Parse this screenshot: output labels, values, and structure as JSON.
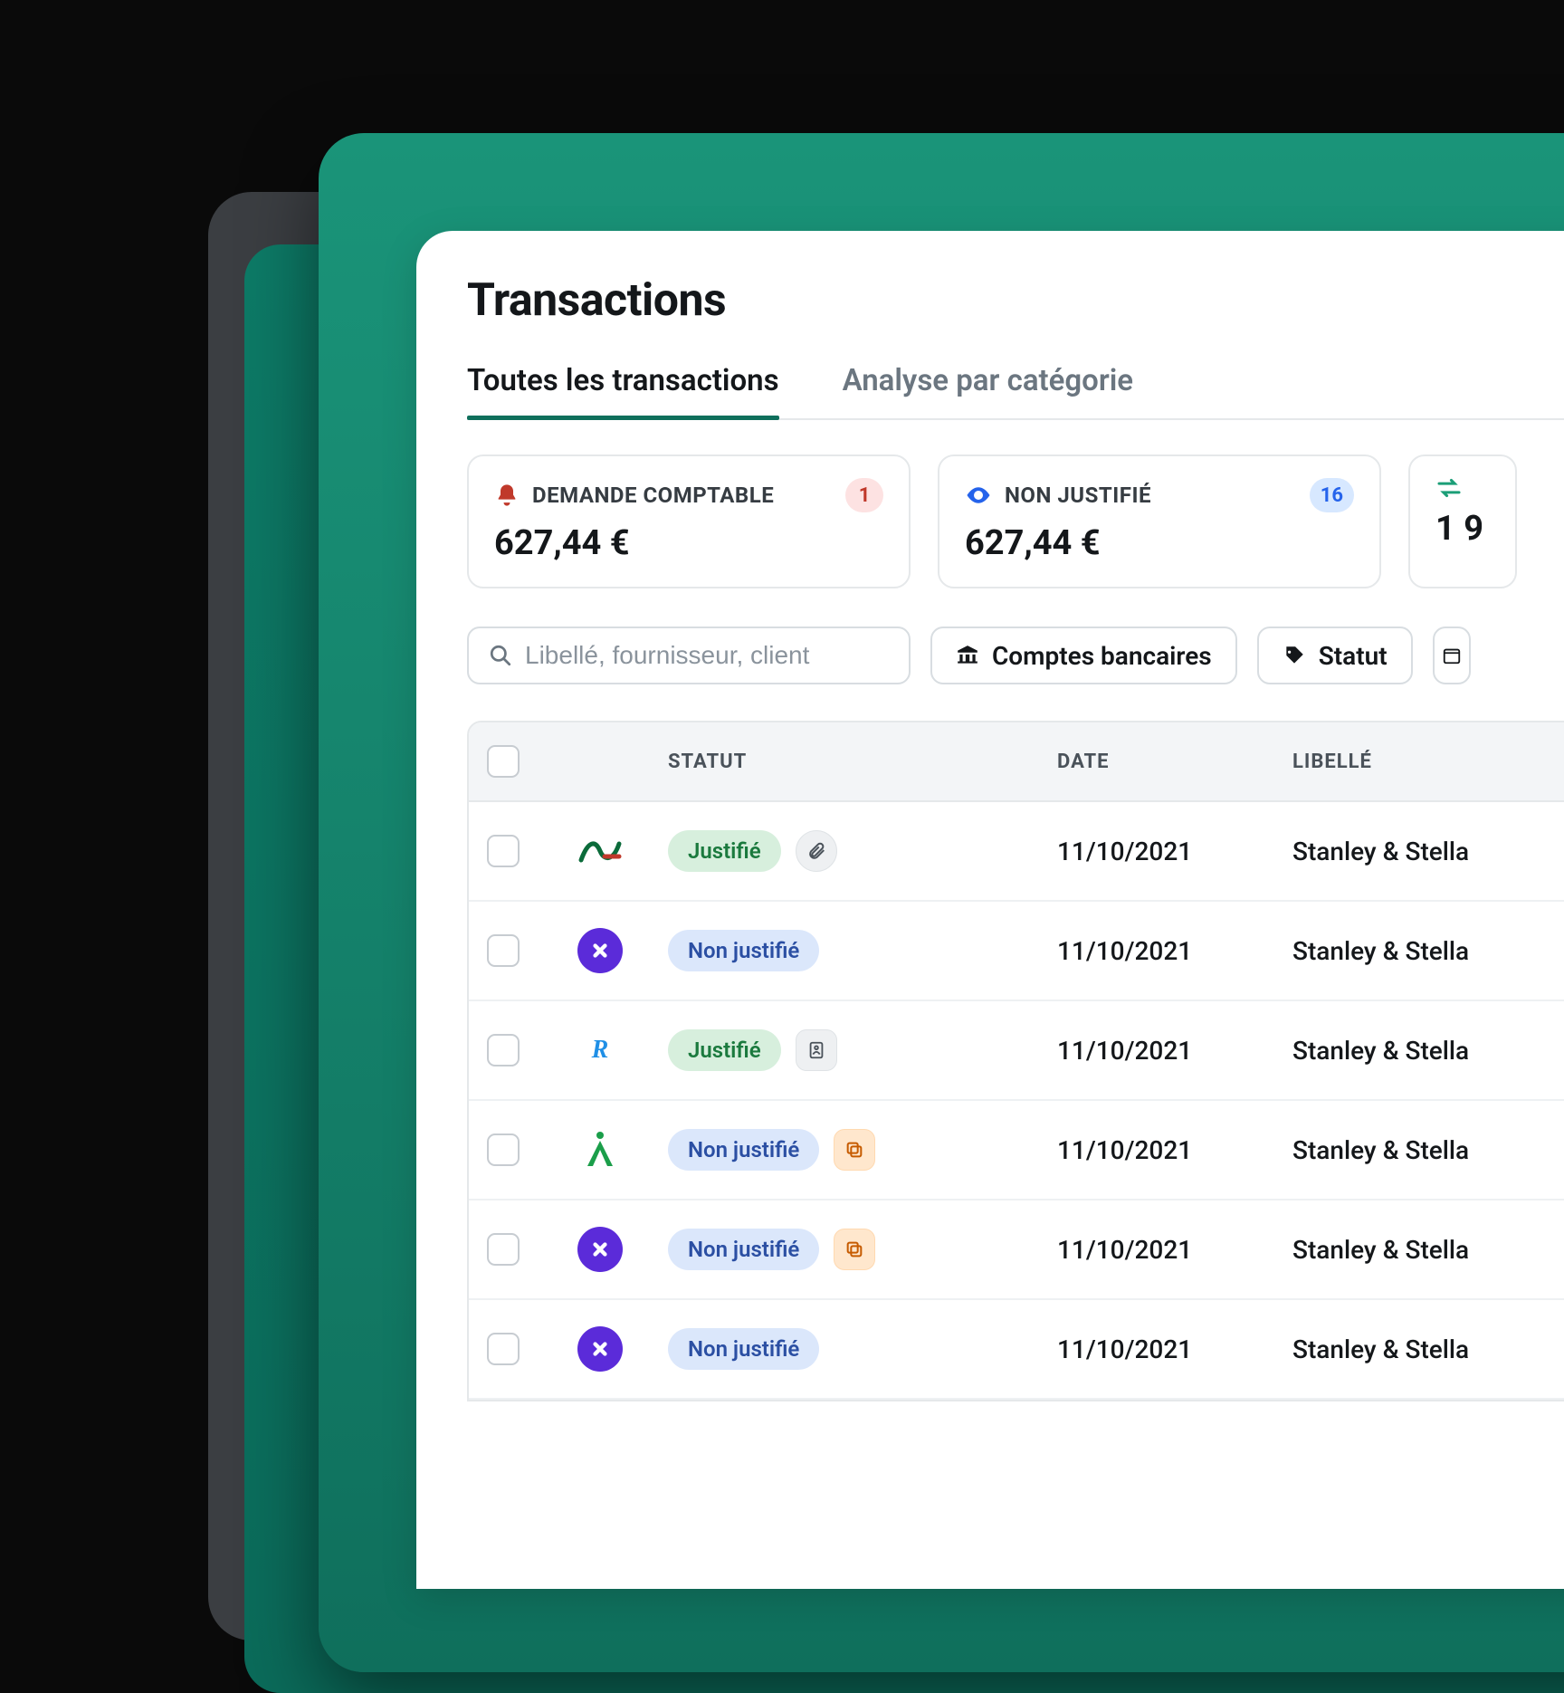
{
  "page_title": "Transactions",
  "tabs": [
    {
      "label": "Toutes les transactions",
      "active": true
    },
    {
      "label": "Analyse par catégorie",
      "active": false
    }
  ],
  "summary": [
    {
      "icon": "bell",
      "icon_color": "#c0392b",
      "label": "DEMANDE COMPTABLE",
      "badge": "1",
      "badge_style": "red",
      "value": "627,44 €"
    },
    {
      "icon": "eye",
      "icon_color": "#2563eb",
      "label": "NON JUSTIFIÉ",
      "badge": "16",
      "badge_style": "blue",
      "value": "627,44 €"
    },
    {
      "icon": "swap",
      "icon_color": "#1b9e77",
      "label": "",
      "badge": "",
      "badge_style": "",
      "value": "1 9"
    }
  ],
  "search": {
    "placeholder": "Libellé, fournisseur, client"
  },
  "filters": [
    {
      "icon": "bank",
      "label": "Comptes bancaires"
    },
    {
      "icon": "tag",
      "label": "Statut"
    }
  ],
  "columns": {
    "status": "STATUT",
    "date": "DATE",
    "label": "LIBELLÉ"
  },
  "rows": [
    {
      "bank": "ca",
      "status": "Justifié",
      "status_style": "green",
      "extra_icon": "paperclip",
      "extra_style": "gray",
      "date": "11/10/2021",
      "label": "Stanley & Stella"
    },
    {
      "bank": "purple-x",
      "status": "Non justifié",
      "status_style": "blue",
      "extra_icon": "",
      "extra_style": "",
      "date": "11/10/2021",
      "label": "Stanley & Stella"
    },
    {
      "bank": "revolut",
      "status": "Justifié",
      "status_style": "green",
      "extra_icon": "receipt",
      "extra_style": "gray",
      "date": "11/10/2021",
      "label": "Stanley & Stella"
    },
    {
      "bank": "star-green",
      "status": "Non justifié",
      "status_style": "blue",
      "extra_icon": "copy",
      "extra_style": "orange",
      "date": "11/10/2021",
      "label": "Stanley & Stella"
    },
    {
      "bank": "purple-x",
      "status": "Non justifié",
      "status_style": "blue",
      "extra_icon": "copy",
      "extra_style": "orange",
      "date": "11/10/2021",
      "label": "Stanley & Stella"
    },
    {
      "bank": "purple-x",
      "status": "Non justifié",
      "status_style": "blue",
      "extra_icon": "",
      "extra_style": "",
      "date": "11/10/2021",
      "label": "Stanley & Stella"
    }
  ]
}
